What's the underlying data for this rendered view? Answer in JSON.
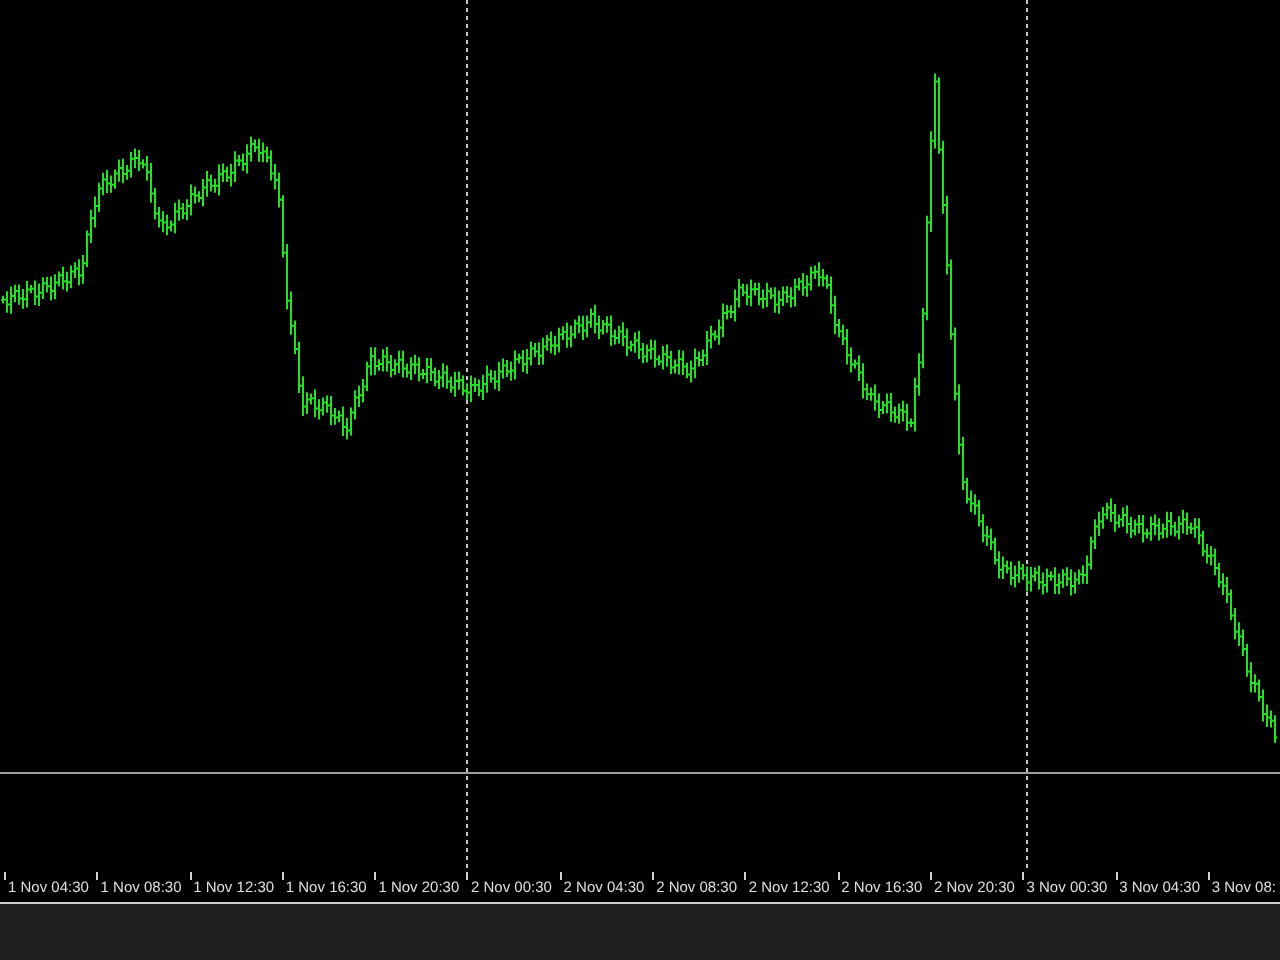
{
  "time_axis": {
    "labels": [
      "1 Nov 04:30",
      "1 Nov 08:30",
      "1 Nov 12:30",
      "1 Nov 16:30",
      "1 Nov 20:30",
      "2 Nov 00:30",
      "2 Nov 04:30",
      "2 Nov 08:30",
      "2 Nov 12:30",
      "2 Nov 16:30",
      "2 Nov 20:30",
      "3 Nov 00:30",
      "3 Nov 04:30",
      "3 Nov 08:"
    ]
  }
}
